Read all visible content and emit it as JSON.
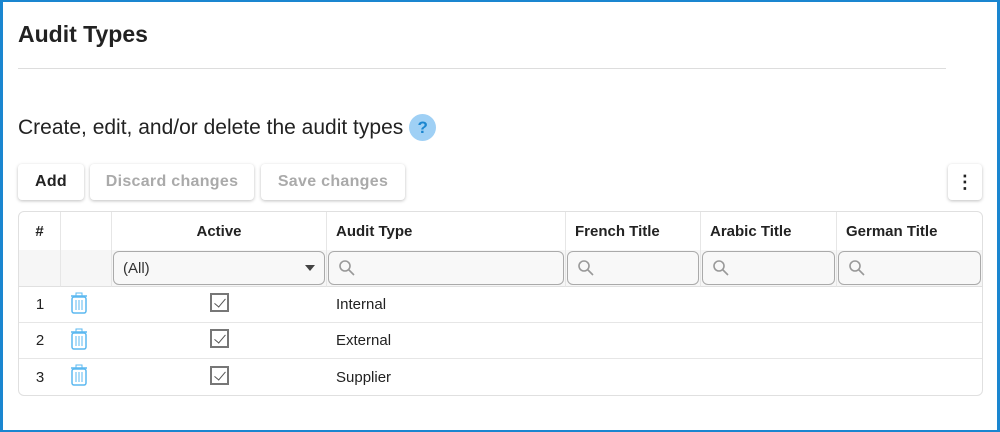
{
  "page": {
    "title": "Audit Types",
    "subtitle": "Create, edit, and/or delete the audit types",
    "help": "?"
  },
  "toolbar": {
    "add": "Add",
    "discard": "Discard changes",
    "save": "Save changes",
    "more": "⋮"
  },
  "table": {
    "headers": [
      "#",
      "",
      "Active",
      "Audit Type",
      "French Title",
      "Arabic Title",
      "German Title"
    ],
    "active_filter": "(All)",
    "rows": [
      {
        "num": "1",
        "active": true,
        "audit_type": "Internal"
      },
      {
        "num": "2",
        "active": true,
        "audit_type": "External"
      },
      {
        "num": "3",
        "active": true,
        "audit_type": "Supplier"
      }
    ]
  },
  "colors": {
    "accent": "#1a86d0",
    "trash": "#5bb8f0"
  }
}
